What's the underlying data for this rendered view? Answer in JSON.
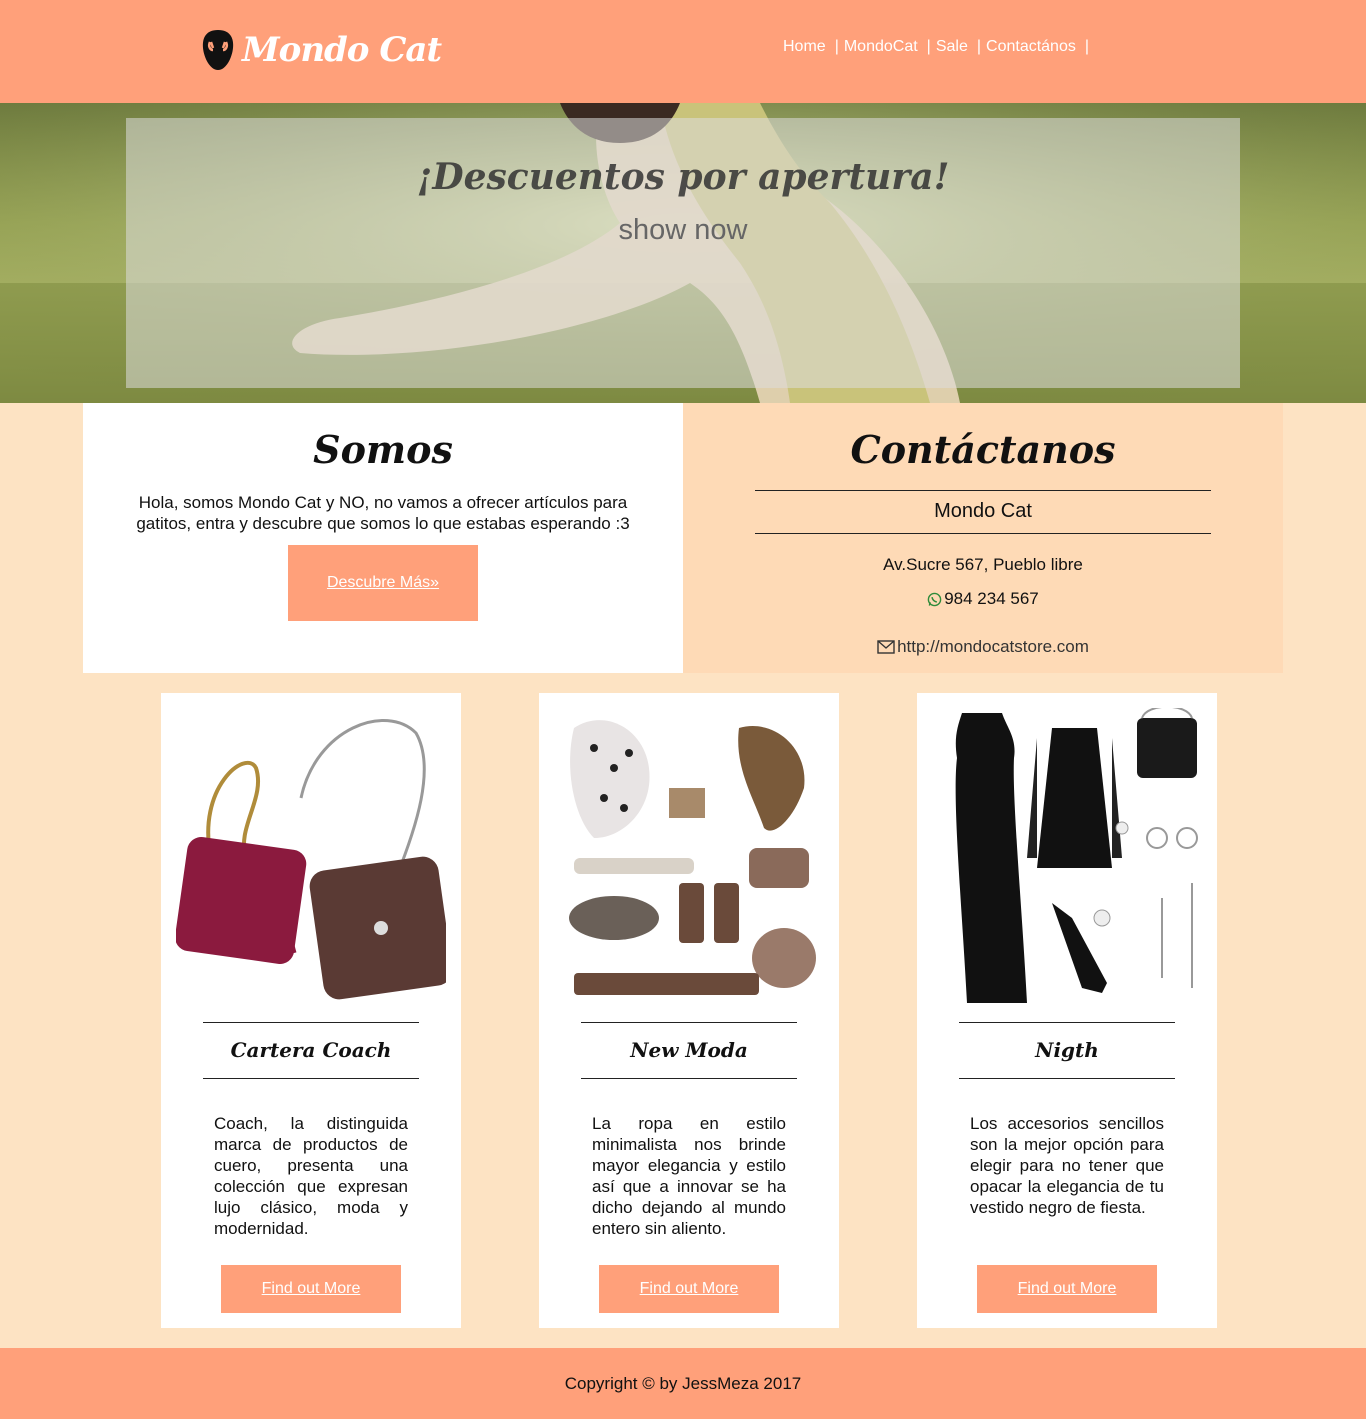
{
  "brand": {
    "name": "Mondo Cat"
  },
  "nav": {
    "items": [
      "Home",
      "MondoCat",
      "Sale",
      "Contactános"
    ],
    "separator": "|"
  },
  "hero": {
    "title": "¡Descuentos por apertura!",
    "button": "show now"
  },
  "somos": {
    "title": "Somos",
    "text": "Hola, somos Mondo Cat y NO, no vamos a ofrecer artículos para gatitos, entra y descubre que somos lo que estabas esperando :3",
    "button": "Descubre Más"
  },
  "contact": {
    "title": "Contáctanos",
    "name": "Mondo Cat",
    "address": "Av.Sucre 567, Pueblo libre",
    "phone": "984 234 567",
    "website": "http://mondocatstore.com"
  },
  "cards": [
    {
      "title": "Cartera Coach",
      "text": "Coach, la distinguida marca de productos de cuero, presenta una colección que expresan lujo clásico, moda y modernidad.",
      "button": "Find out More"
    },
    {
      "title": "New Moda",
      "text": "La ropa en estilo minimalista nos brinde mayor elegancia y estilo así que a innovar se ha dicho dejando al mundo entero sin aliento.",
      "button": "Find out More"
    },
    {
      "title": "Nigth",
      "text": "Los accesorios sencillos son la mejor opción para elegir para no tener que opacar la elegancia de tu vestido negro de fiesta.",
      "button": "Find out More"
    }
  ],
  "footer": {
    "copyright": "Copyright © by JessMeza 2017"
  },
  "colors": {
    "accent": "#ffa07a",
    "page_bg": "#fde3c3",
    "contact_bg": "#fedab6"
  },
  "icons": {
    "logo": "cat-head-icon",
    "phone": "whatsapp-icon",
    "web": "envelope-icon",
    "button_arrow": "double-chevron-right-icon"
  }
}
